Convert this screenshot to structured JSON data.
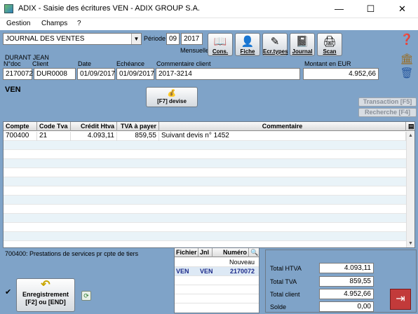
{
  "window": {
    "title": "ADIX - Saisie des écritures  VEN - ADIX GROUP S.A.",
    "minimize": "—",
    "maximize": "☐",
    "close": "✕"
  },
  "menu": {
    "items": [
      "Gestion",
      "Champs",
      "?"
    ]
  },
  "header": {
    "journal": "JOURNAL DES VENTES",
    "periode_label": "Période",
    "periode_month": "09",
    "periode_year": "2017",
    "mensuelle_label": "Mensuelle",
    "client_name": "DURANT JEAN",
    "labels": {
      "ndoc": "N°doc",
      "client": "Client",
      "date": "Date",
      "echeance": "Echéance",
      "commentaire": "Commentaire client",
      "montant": "Montant en EUR"
    },
    "values": {
      "ndoc": "2170072",
      "client": "DUR0008",
      "date": "01/09/2017",
      "echeance": "01/09/2017",
      "commentaire": "2017-3214",
      "montant": "4.952,66"
    }
  },
  "toolbar": [
    {
      "label": "Cons.",
      "icon": "book-icon",
      "glyph": "📖"
    },
    {
      "label": "Fiche",
      "icon": "user-icon",
      "glyph": "👤"
    },
    {
      "label": "Ecr.types",
      "icon": "pen-icon",
      "glyph": "✎"
    },
    {
      "label": "Journal",
      "icon": "journal-icon",
      "glyph": "📓"
    },
    {
      "label": "Scan",
      "icon": "scanner-icon",
      "glyph": "🖨"
    }
  ],
  "ven": {
    "label": "VEN",
    "devise_label": "[F7] devise"
  },
  "side_buttons": {
    "transaction": "Transaction [F5]",
    "recherche": "Recherche [F4]"
  },
  "grid": {
    "columns": [
      "Compte",
      "Code Tva",
      "Crédit Htva",
      "TVA à payer",
      "Commentaire"
    ],
    "rows": [
      [
        "700400",
        "21",
        "4.093,11",
        "859,55",
        "Suivant devis n° 1452"
      ]
    ]
  },
  "account_desc": "700400: Prestations de services pr cpte de tiers",
  "files": {
    "columns": [
      "Fichier",
      "Jnl",
      "Numéro"
    ],
    "new_label": "Nouveau",
    "rows": [
      [
        "VEN",
        "VEN",
        "2170072"
      ]
    ]
  },
  "totals": [
    {
      "label": "Total HTVA",
      "value": "4.093,11"
    },
    {
      "label": "Total TVA",
      "value": "859,55"
    },
    {
      "label": "Total client",
      "value": "4.952,66"
    },
    {
      "label": "Solde",
      "value": "0,00"
    }
  ],
  "save": {
    "line1": "Enregistrement",
    "line2": "[F2] ou [END]"
  },
  "colors": {
    "background": "#7fa3c8",
    "selected_text": "#1b2a8a"
  }
}
